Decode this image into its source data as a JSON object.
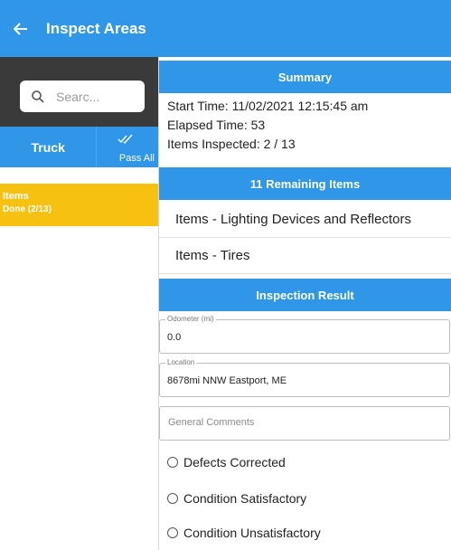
{
  "header": {
    "title": "Inspect Areas",
    "back_icon": "arrow-left-icon"
  },
  "sidebar": {
    "search_placeholder": "Searc...",
    "tabs": {
      "truck_label": "Truck",
      "pass_all_label": "Pass All"
    },
    "areas": [
      {
        "name": "Items",
        "status": "Done (2/13)"
      }
    ]
  },
  "summary": {
    "title": "Summary",
    "start_time": "Start Time: 11/02/2021 12:15:45 am",
    "elapsed_time": "Elapsed Time: 53",
    "items_inspected": "Items Inspected: 2 / 13"
  },
  "remaining": {
    "title": "11 Remaining Items",
    "items": [
      "Items - Lighting Devices and Reflectors",
      "Items - Tires"
    ]
  },
  "result": {
    "title": "Inspection Result",
    "odometer": {
      "label": "Odometer (mi)",
      "value": "0.0"
    },
    "location": {
      "label": "Location",
      "value": "8678mi NNW Eastport, ME"
    },
    "comments": {
      "placeholder": "General Comments"
    },
    "options": [
      "Defects Corrected",
      "Condition Satisfactory",
      "Condition Unsatisfactory"
    ]
  },
  "colors": {
    "primary": "#2f96e8",
    "accent": "#f6c111",
    "dark": "#3a3a3a"
  }
}
